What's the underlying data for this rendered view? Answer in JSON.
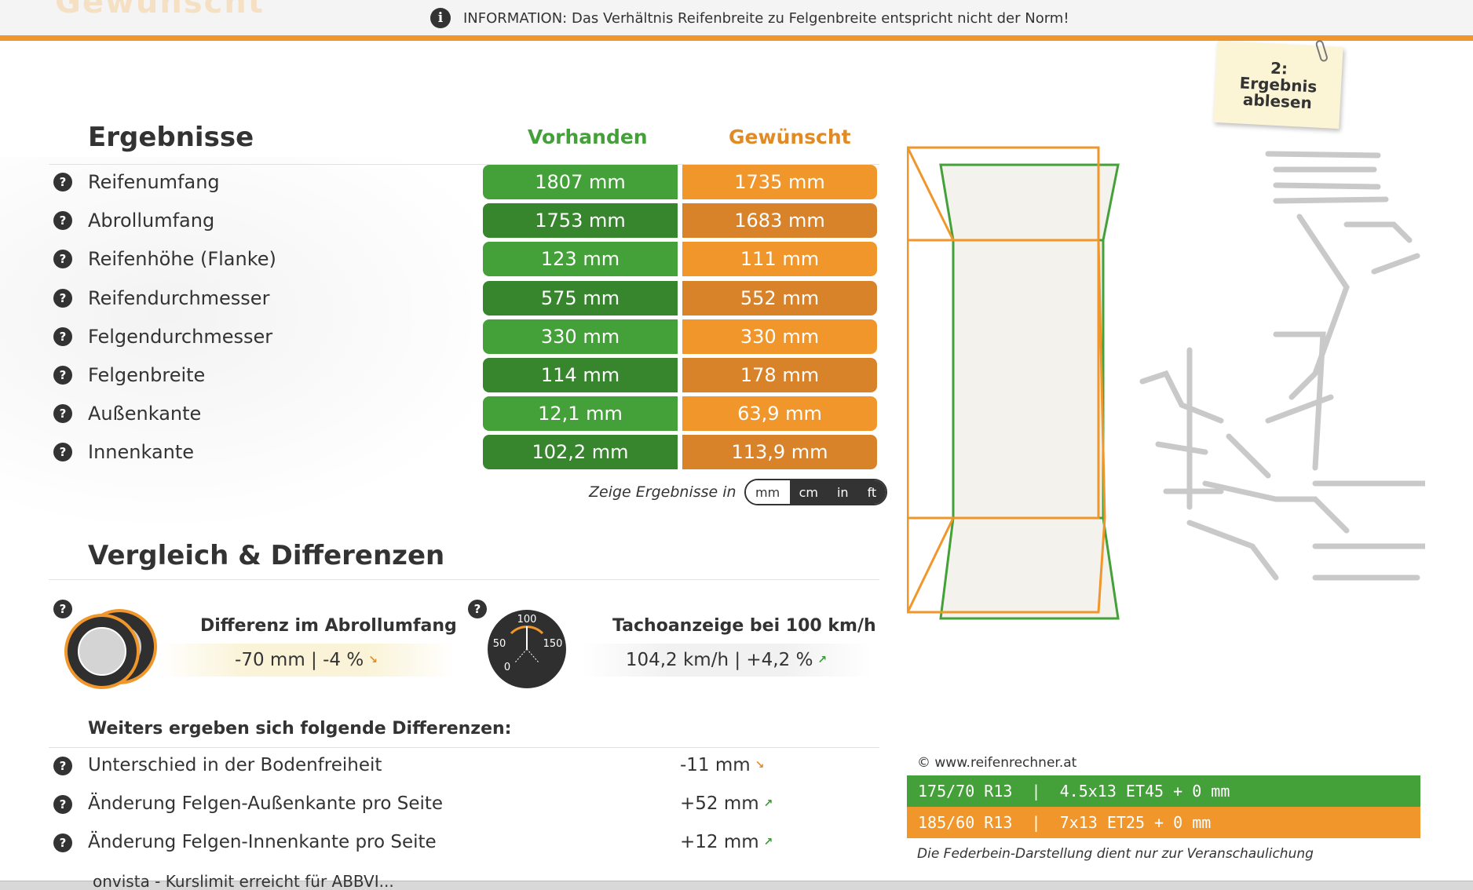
{
  "info_bar": {
    "text": "INFORMATION: Das Verhältnis Reifenbreite zu Felgenbreite entspricht nicht der Norm!",
    "ghost_logo": "Gewünscht"
  },
  "note": {
    "text": "2: Ergebnis ablesen"
  },
  "results": {
    "title": "Ergebnisse",
    "col_existing": "Vorhanden",
    "col_desired": "Gewünscht",
    "rows": [
      {
        "label": "Reifenumfang",
        "existing": "1807 mm",
        "desired": "1735 mm"
      },
      {
        "label": "Abrollumfang",
        "existing": "1753 mm",
        "desired": "1683 mm"
      },
      {
        "label": "Reifenhöhe (Flanke)",
        "existing": "123 mm",
        "desired": "111 mm"
      },
      {
        "label": "Reifendurchmesser",
        "existing": "575 mm",
        "desired": "552 mm"
      },
      {
        "label": "Felgendurchmesser",
        "existing": "330 mm",
        "desired": "330 mm"
      },
      {
        "label": "Felgenbreite",
        "existing": "114 mm",
        "desired": "178 mm"
      },
      {
        "label": "Außenkante",
        "existing": "12,1 mm",
        "desired": "63,9 mm"
      },
      {
        "label": "Innenkante",
        "existing": "102,2 mm",
        "desired": "113,9 mm"
      }
    ],
    "units_label": "Zeige Ergebnisse in",
    "units": [
      "mm",
      "cm",
      "in",
      "ft"
    ],
    "selected_unit": "mm"
  },
  "comparison": {
    "title": "Vergleich & Differenzen",
    "circumference_title": "Differenz im Abrollumfang",
    "circumference_value": "-70 mm | -4 %",
    "tacho_title": "Tachoanzeige bei 100 km/h",
    "tacho_value": "104,2 km/h | +4,2 %",
    "tacho_labels": {
      "top": "100",
      "left": "50",
      "right": "150",
      "bottom": "0"
    },
    "further_title": "Weiters ergeben sich folgende Differenzen:",
    "further": [
      {
        "label": "Unterschied in der Bodenfreiheit",
        "value": "-11 mm",
        "trend": "down"
      },
      {
        "label": "Änderung Felgen-Außenkante pro Seite",
        "value": "+52 mm",
        "trend": "up"
      },
      {
        "label": "Änderung Felgen-Innenkante pro Seite",
        "value": "+12 mm",
        "trend": "up"
      }
    ]
  },
  "diagram": {
    "copyright": "© www.reifenrechner.at",
    "spec_existing": "175/70 R13  |  4.5x13 ET45 + 0 mm",
    "spec_desired": "185/60 R13  |  7x13 ET25 + 0 mm",
    "disclaimer": "Die Federbein-Darstellung dient nur zur Veranschaulichung"
  },
  "bottom_bar": {
    "text": "onvista - Kurslimit erreicht für ABBVI..."
  },
  "colors": {
    "green": "#44a038",
    "orange": "#f0962b",
    "dark": "#333333"
  }
}
